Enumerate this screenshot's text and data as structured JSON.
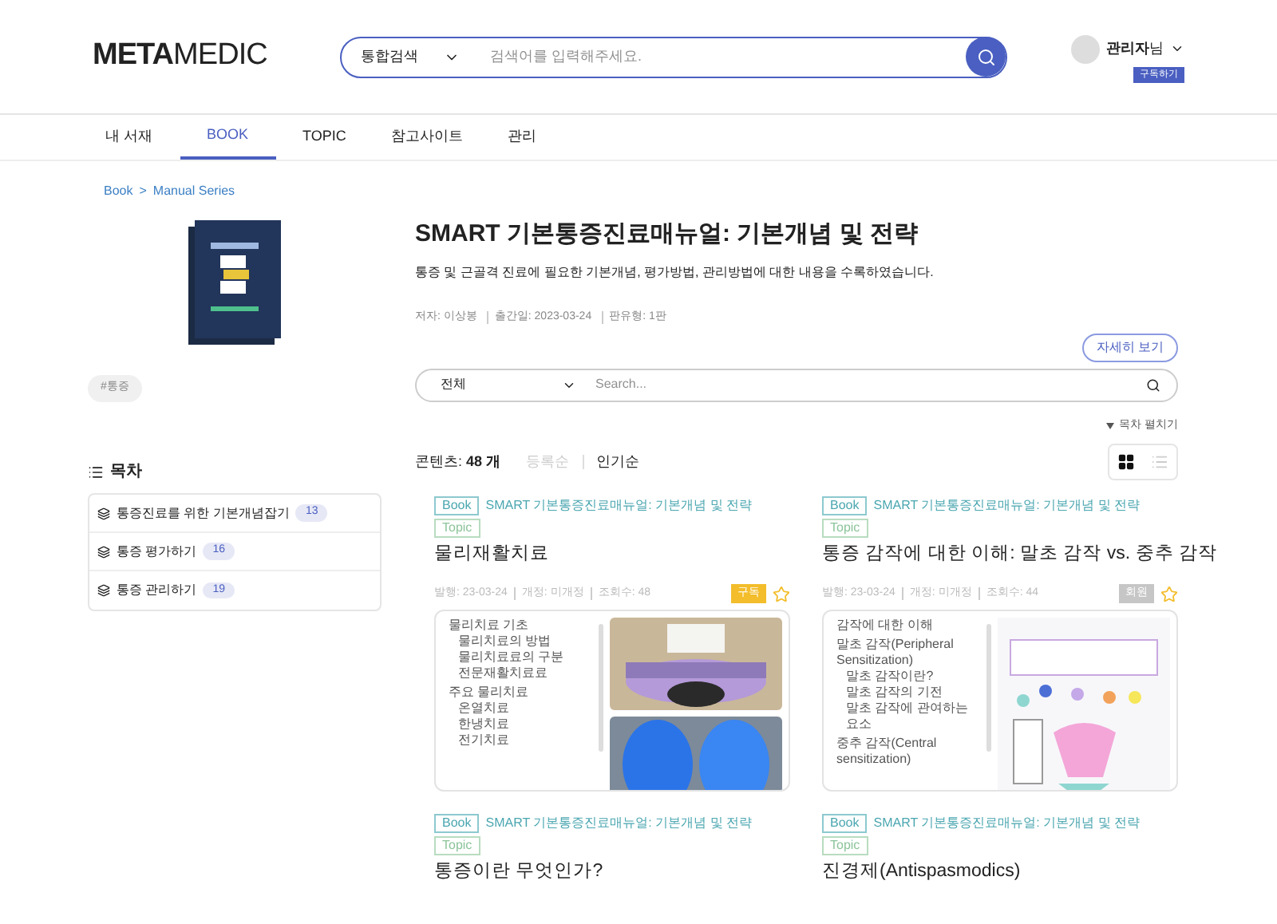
{
  "header": {
    "logo_bold": "META",
    "logo_light": "MEDIC",
    "search": {
      "scope": "통합검색",
      "placeholder": "검색어를 입력해주세요."
    },
    "user": {
      "name": "관리자",
      "suffix": "님",
      "subscribe": "구독하기"
    }
  },
  "nav": [
    {
      "label": "내 서재",
      "selected": false
    },
    {
      "label": "BOOK",
      "selected": true
    },
    {
      "label": "TOPIC",
      "selected": false
    },
    {
      "label": "참고사이트",
      "selected": false
    },
    {
      "label": "관리",
      "selected": false
    }
  ],
  "breadcrumb": [
    "Book",
    ">",
    "Manual Series"
  ],
  "tag": "#통증",
  "toc": {
    "title": "목차",
    "items": [
      {
        "label": "통증진료를 위한 기본개념잡기",
        "count": "13"
      },
      {
        "label": "통증 평가하기",
        "count": "16"
      },
      {
        "label": "통증 관리하기",
        "count": "19"
      }
    ]
  },
  "book": {
    "title": "SMART 기본통증진료매뉴얼: 기본개념 및 전략",
    "description": "통증 및 근골격 진료에 필요한 기본개념, 평가방법, 관리방법에 대한 내용을 수록하였습니다.",
    "meta": [
      "저자: 이상봉",
      "출간일: 2023-03-24",
      "판유형: 1판"
    ],
    "detail_button": "자세히 보기"
  },
  "filter": {
    "scope": "전체",
    "placeholder": "Search...",
    "expand_toc": "목차 펼치기"
  },
  "contents": {
    "label": "콘텐츠:",
    "count": "48 개",
    "sorts": [
      {
        "label": "등록순",
        "selected": false
      },
      {
        "label": "인기순",
        "selected": true
      }
    ],
    "views": [
      {
        "kind": "grid",
        "selected": true
      },
      {
        "kind": "list",
        "selected": false
      }
    ]
  },
  "cards": [
    {
      "book": "Book",
      "book_title": "SMART 기본통증진료매뉴얼: 기본개념 및 전략",
      "topic": "Topic",
      "title": "물리재활치료",
      "meta": [
        "발행: 23-03-24",
        "개정: 미개정",
        "조회수: 48"
      ],
      "badge": {
        "label": "구독",
        "kind": "subscribe"
      },
      "starred": false,
      "outline": [
        {
          "label": "물리치료 기초",
          "children": [
            {
              "label": "물리치료의 방법"
            },
            {
              "label": "물리치료료의 구분"
            },
            {
              "label": "전문재활치료료"
            }
          ]
        },
        {
          "label": "주요 물리치료",
          "children": [
            {
              "label": "온열치료"
            },
            {
              "label": "한냉치료"
            },
            {
              "label": "전기치료"
            }
          ]
        }
      ],
      "preview": {
        "kind": "photos"
      }
    },
    {
      "book": "Book",
      "book_title": "SMART 기본통증진료매뉴얼: 기본개념 및 전략",
      "topic": "Topic",
      "title": "통증 감작에 대한 이해: 말초 감작 vs. 중추 감작",
      "meta": [
        "발행: 23-03-24",
        "개정: 미개정",
        "조회수: 44"
      ],
      "badge": {
        "label": "회원",
        "kind": "member"
      },
      "starred": false,
      "outline": [
        {
          "label": "감작에 대한 이해"
        },
        {
          "label": "말초 감작(Peripheral Sensitization)",
          "children": [
            {
              "label": "말초 감작이란?"
            },
            {
              "label": "말초 감작의 기전"
            },
            {
              "label": "말초 감작에 관여하는 요소"
            }
          ]
        },
        {
          "label": "중추 감작(Central sensitization)"
        }
      ],
      "preview": {
        "kind": "diagram"
      }
    },
    {
      "book": "Book",
      "book_title": "SMART 기본통증진료매뉴얼: 기본개념 및 전략",
      "topic": "Topic",
      "title": "통증이란 무엇인가?"
    },
    {
      "book": "Book",
      "book_title": "SMART 기본통증진료매뉴얼: 기본개념 및 전략",
      "topic": "Topic",
      "title": "진경제(Antispasmodics)"
    }
  ]
}
